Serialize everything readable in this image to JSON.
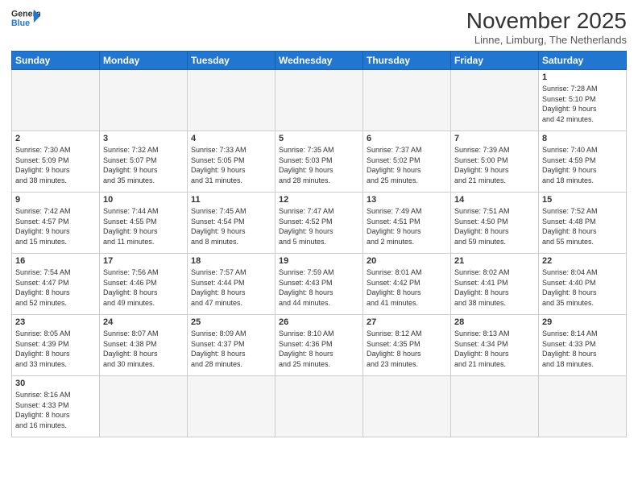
{
  "header": {
    "logo_general": "General",
    "logo_blue": "Blue",
    "month": "November 2025",
    "location": "Linne, Limburg, The Netherlands"
  },
  "weekdays": [
    "Sunday",
    "Monday",
    "Tuesday",
    "Wednesday",
    "Thursday",
    "Friday",
    "Saturday"
  ],
  "weeks": [
    [
      {
        "day": "",
        "info": ""
      },
      {
        "day": "",
        "info": ""
      },
      {
        "day": "",
        "info": ""
      },
      {
        "day": "",
        "info": ""
      },
      {
        "day": "",
        "info": ""
      },
      {
        "day": "",
        "info": ""
      },
      {
        "day": "1",
        "info": "Sunrise: 7:28 AM\nSunset: 5:10 PM\nDaylight: 9 hours\nand 42 minutes."
      }
    ],
    [
      {
        "day": "2",
        "info": "Sunrise: 7:30 AM\nSunset: 5:09 PM\nDaylight: 9 hours\nand 38 minutes."
      },
      {
        "day": "3",
        "info": "Sunrise: 7:32 AM\nSunset: 5:07 PM\nDaylight: 9 hours\nand 35 minutes."
      },
      {
        "day": "4",
        "info": "Sunrise: 7:33 AM\nSunset: 5:05 PM\nDaylight: 9 hours\nand 31 minutes."
      },
      {
        "day": "5",
        "info": "Sunrise: 7:35 AM\nSunset: 5:03 PM\nDaylight: 9 hours\nand 28 minutes."
      },
      {
        "day": "6",
        "info": "Sunrise: 7:37 AM\nSunset: 5:02 PM\nDaylight: 9 hours\nand 25 minutes."
      },
      {
        "day": "7",
        "info": "Sunrise: 7:39 AM\nSunset: 5:00 PM\nDaylight: 9 hours\nand 21 minutes."
      },
      {
        "day": "8",
        "info": "Sunrise: 7:40 AM\nSunset: 4:59 PM\nDaylight: 9 hours\nand 18 minutes."
      }
    ],
    [
      {
        "day": "9",
        "info": "Sunrise: 7:42 AM\nSunset: 4:57 PM\nDaylight: 9 hours\nand 15 minutes."
      },
      {
        "day": "10",
        "info": "Sunrise: 7:44 AM\nSunset: 4:55 PM\nDaylight: 9 hours\nand 11 minutes."
      },
      {
        "day": "11",
        "info": "Sunrise: 7:45 AM\nSunset: 4:54 PM\nDaylight: 9 hours\nand 8 minutes."
      },
      {
        "day": "12",
        "info": "Sunrise: 7:47 AM\nSunset: 4:52 PM\nDaylight: 9 hours\nand 5 minutes."
      },
      {
        "day": "13",
        "info": "Sunrise: 7:49 AM\nSunset: 4:51 PM\nDaylight: 9 hours\nand 2 minutes."
      },
      {
        "day": "14",
        "info": "Sunrise: 7:51 AM\nSunset: 4:50 PM\nDaylight: 8 hours\nand 59 minutes."
      },
      {
        "day": "15",
        "info": "Sunrise: 7:52 AM\nSunset: 4:48 PM\nDaylight: 8 hours\nand 55 minutes."
      }
    ],
    [
      {
        "day": "16",
        "info": "Sunrise: 7:54 AM\nSunset: 4:47 PM\nDaylight: 8 hours\nand 52 minutes."
      },
      {
        "day": "17",
        "info": "Sunrise: 7:56 AM\nSunset: 4:46 PM\nDaylight: 8 hours\nand 49 minutes."
      },
      {
        "day": "18",
        "info": "Sunrise: 7:57 AM\nSunset: 4:44 PM\nDaylight: 8 hours\nand 47 minutes."
      },
      {
        "day": "19",
        "info": "Sunrise: 7:59 AM\nSunset: 4:43 PM\nDaylight: 8 hours\nand 44 minutes."
      },
      {
        "day": "20",
        "info": "Sunrise: 8:01 AM\nSunset: 4:42 PM\nDaylight: 8 hours\nand 41 minutes."
      },
      {
        "day": "21",
        "info": "Sunrise: 8:02 AM\nSunset: 4:41 PM\nDaylight: 8 hours\nand 38 minutes."
      },
      {
        "day": "22",
        "info": "Sunrise: 8:04 AM\nSunset: 4:40 PM\nDaylight: 8 hours\nand 35 minutes."
      }
    ],
    [
      {
        "day": "23",
        "info": "Sunrise: 8:05 AM\nSunset: 4:39 PM\nDaylight: 8 hours\nand 33 minutes."
      },
      {
        "day": "24",
        "info": "Sunrise: 8:07 AM\nSunset: 4:38 PM\nDaylight: 8 hours\nand 30 minutes."
      },
      {
        "day": "25",
        "info": "Sunrise: 8:09 AM\nSunset: 4:37 PM\nDaylight: 8 hours\nand 28 minutes."
      },
      {
        "day": "26",
        "info": "Sunrise: 8:10 AM\nSunset: 4:36 PM\nDaylight: 8 hours\nand 25 minutes."
      },
      {
        "day": "27",
        "info": "Sunrise: 8:12 AM\nSunset: 4:35 PM\nDaylight: 8 hours\nand 23 minutes."
      },
      {
        "day": "28",
        "info": "Sunrise: 8:13 AM\nSunset: 4:34 PM\nDaylight: 8 hours\nand 21 minutes."
      },
      {
        "day": "29",
        "info": "Sunrise: 8:14 AM\nSunset: 4:33 PM\nDaylight: 8 hours\nand 18 minutes."
      }
    ],
    [
      {
        "day": "30",
        "info": "Sunrise: 8:16 AM\nSunset: 4:33 PM\nDaylight: 8 hours\nand 16 minutes."
      },
      {
        "day": "",
        "info": ""
      },
      {
        "day": "",
        "info": ""
      },
      {
        "day": "",
        "info": ""
      },
      {
        "day": "",
        "info": ""
      },
      {
        "day": "",
        "info": ""
      },
      {
        "day": "",
        "info": ""
      }
    ]
  ]
}
